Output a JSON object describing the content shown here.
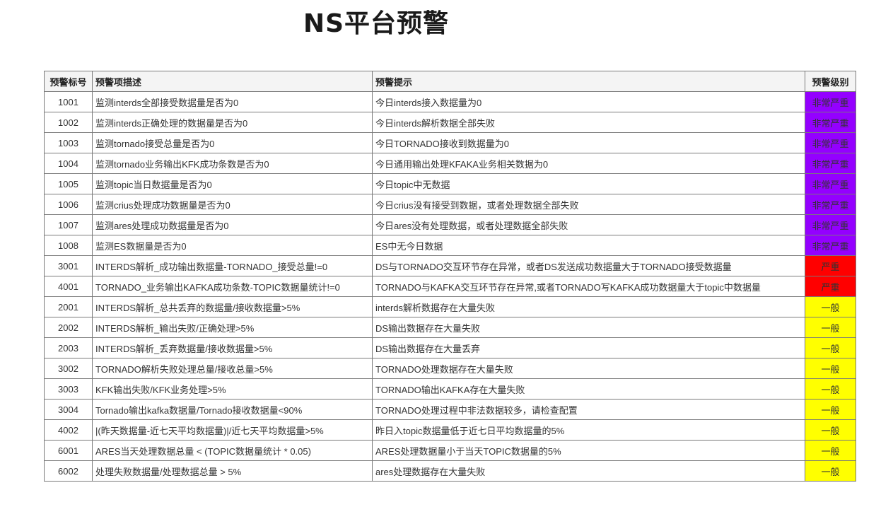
{
  "page": {
    "title": "NS平台预警"
  },
  "colors": {
    "very_severe": "#9400ff",
    "severe": "#ff0000",
    "normal": "#ffff00",
    "border": "#7a7a7a"
  },
  "table": {
    "headers": {
      "id": "预警标号",
      "desc": "预警项描述",
      "hint": "预警提示",
      "level": "预警级别"
    },
    "rows": [
      {
        "id": "1001",
        "desc": "监测interds全部接受数据量是否为0",
        "hint": "今日interds接入数据量为0",
        "level": "非常严重",
        "level_class": "lv-critical"
      },
      {
        "id": "1002",
        "desc": "监测interds正确处理的数据量是否为0",
        "hint": "今日interds解析数据全部失败",
        "level": "非常严重",
        "level_class": "lv-critical"
      },
      {
        "id": "1003",
        "desc": "监测tornado接受总量是否为0",
        "hint": "今日TORNADO接收到数据量为0",
        "level": "非常严重",
        "level_class": "lv-critical"
      },
      {
        "id": "1004",
        "desc": "监测tornado业务输出KFK成功条数是否为0",
        "hint": "今日通用输出处理KFAKA业务相关数据为0",
        "level": "非常严重",
        "level_class": "lv-critical"
      },
      {
        "id": "1005",
        "desc": "监测topic当日数据量是否为0",
        "hint": "今日topic中无数据",
        "level": "非常严重",
        "level_class": "lv-critical"
      },
      {
        "id": "1006",
        "desc": "监测crius处理成功数据量是否为0",
        "hint": "今日crius没有接受到数据，或者处理数据全部失败",
        "level": "非常严重",
        "level_class": "lv-critical"
      },
      {
        "id": "1007",
        "desc": "监测ares处理成功数据量是否为0",
        "hint": "今日ares没有处理数据，或者处理数据全部失败",
        "level": "非常严重",
        "level_class": "lv-critical"
      },
      {
        "id": "1008",
        "desc": "监测ES数据量是否为0",
        "hint": "ES中无今日数据",
        "level": "非常严重",
        "level_class": "lv-critical"
      },
      {
        "id": "3001",
        "desc": "INTERDS解析_成功输出数据量-TORNADO_接受总量!=0",
        "hint": "DS与TORNADO交互环节存在异常，或者DS发送成功数据量大于TORNADO接受数据量",
        "level": "严重",
        "level_class": "lv-severe"
      },
      {
        "id": "4001",
        "desc": "TORNADO_业务输出KAFKA成功条数-TOPIC数据量统计!=0",
        "hint": "TORNADO与KAFKA交互环节存在异常,或者TORNADO写KAFKA成功数据量大于topic中数据量",
        "level": "严重",
        "level_class": "lv-severe"
      },
      {
        "id": "2001",
        "desc": "INTERDS解析_总共丢弃的数据量/接收数据量>5%",
        "hint": "interds解析数据存在大量失败",
        "level": "一般",
        "level_class": "lv-normal"
      },
      {
        "id": "2002",
        "desc": "INTERDS解析_输出失败/正确处理>5%",
        "hint": "DS输出数据存在大量失败",
        "level": "一般",
        "level_class": "lv-normal"
      },
      {
        "id": "2003",
        "desc": "INTERDS解析_丢弃数据量/接收数据量>5%",
        "hint": "DS输出数据存在大量丢弃",
        "level": "一般",
        "level_class": "lv-normal"
      },
      {
        "id": "3002",
        "desc": "TORNADO解析失败处理总量/接收总量>5%",
        "hint": "TORNADO处理数据存在大量失败",
        "level": "一般",
        "level_class": "lv-normal"
      },
      {
        "id": "3003",
        "desc": "KFK输出失败/KFK业务处理>5%",
        "hint": "TORNADO输出KAFKA存在大量失败",
        "level": "一般",
        "level_class": "lv-normal"
      },
      {
        "id": "3004",
        "desc": "Tornado输出kafka数据量/Tornado接收数据量<90%",
        "hint": "TORNADO处理过程中非法数据较多，请检查配置",
        "level": "一般",
        "level_class": "lv-normal"
      },
      {
        "id": "4002",
        "desc": "|(昨天数据量-近七天平均数据量)|/近七天平均数据量>5%",
        "hint": "昨日入topic数据量低于近七日平均数据量的5%",
        "level": "一般",
        "level_class": "lv-normal"
      },
      {
        "id": "6001",
        "desc": "ARES当天处理数据总量 < (TOPIC数据量统计 * 0.05)",
        "hint": "ARES处理数据量小于当天TOPIC数据量的5%",
        "level": "一般",
        "level_class": "lv-normal"
      },
      {
        "id": "6002",
        "desc": "处理失败数据量/处理数据总量 > 5%",
        "hint": "ares处理数据存在大量失败",
        "level": "一般",
        "level_class": "lv-normal"
      }
    ]
  }
}
